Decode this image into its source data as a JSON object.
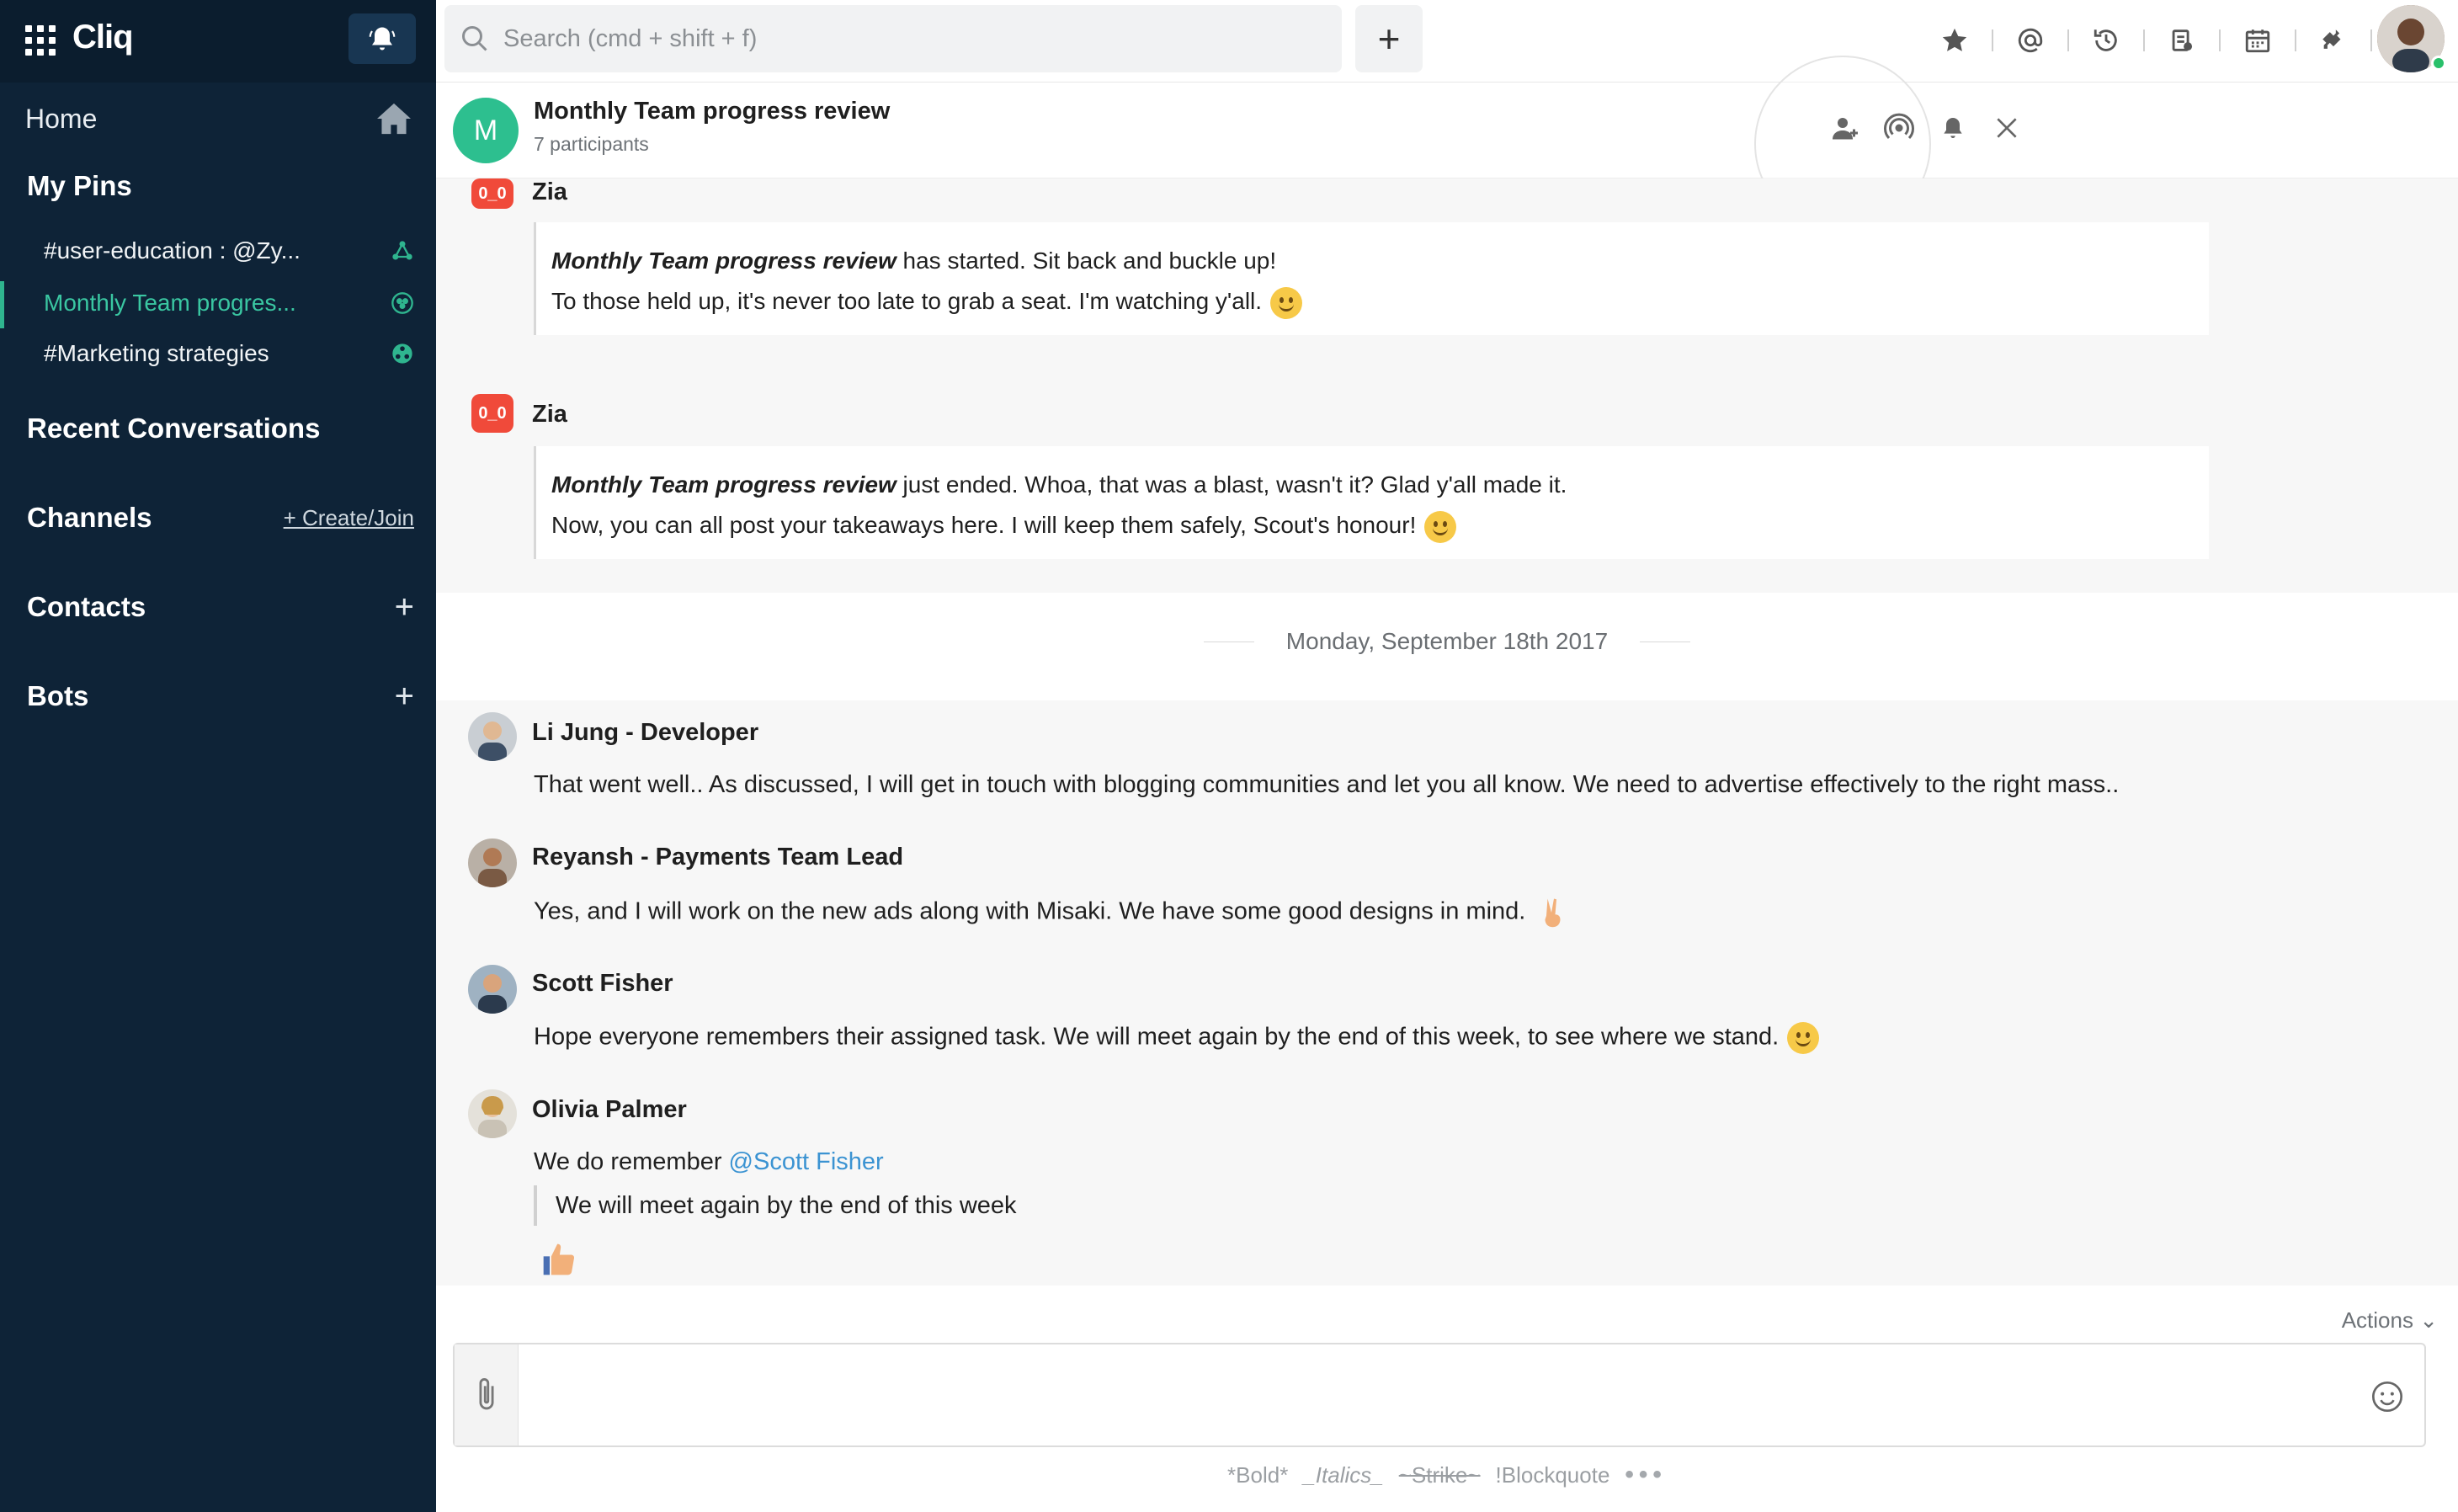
{
  "app": {
    "brand": "Cliq"
  },
  "sidebar": {
    "home": "Home",
    "my_pins": "My Pins",
    "pins": [
      {
        "label": "#user-education : @Zy..."
      },
      {
        "label": "Monthly Team progres..."
      },
      {
        "label": "#Marketing strategies"
      }
    ],
    "recent": "Recent Conversations",
    "channels": "Channels",
    "create_join": "+ Create/Join",
    "contacts": "Contacts",
    "bots": "Bots"
  },
  "search": {
    "placeholder": "Search (cmd + shift + f)"
  },
  "chat": {
    "avatar_letter": "M",
    "title": "Monthly Team progress review",
    "participants": "7 participants"
  },
  "messages": {
    "zia1": {
      "sender": "Zia",
      "bot_label": "0_0",
      "line1_bold": "Monthly Team progress review",
      "line1_rest": " has started. Sit back and buckle up!",
      "line2": "To those held up, it's never too late to grab a seat. I'm watching y'all."
    },
    "zia2": {
      "sender": "Zia",
      "bot_label": "0_0",
      "line1_bold": "Monthly Team progress review",
      "line1_rest": " just ended. Whoa, that was a blast, wasn't it? Glad y'all made it.",
      "line2": "Now, you can all post your takeaways here. I will keep them safely, Scout's honour!"
    },
    "date": "Monday, September 18th 2017",
    "m1": {
      "sender": "Li Jung - Developer",
      "text": "That went well.. As discussed, I will get in touch with blogging communities and let you all know. We need to advertise effectively to the right mass.."
    },
    "m2": {
      "sender": "Reyansh - Payments Team Lead",
      "text": "Yes, and I will work on the new ads along with Misaki. We have some good designs in mind."
    },
    "m3": {
      "sender": "Scott Fisher",
      "text": "Hope everyone remembers their assigned task. We will meet again by the end of this week, to see where we stand."
    },
    "m4": {
      "sender": "Olivia Palmer",
      "text": "We do remember ",
      "mention": "@Scott Fisher",
      "quote": "We will meet again by the end of this week"
    }
  },
  "composer": {
    "actions": "Actions",
    "bold": "*Bold*",
    "italics": "_Italics_",
    "strike": "~Strike~",
    "blockquote": "!Blockquote",
    "more": "•••"
  },
  "colors": {
    "sidebar": "#0e2337",
    "accent": "#2dbf8f",
    "mention": "#3b93d2"
  }
}
